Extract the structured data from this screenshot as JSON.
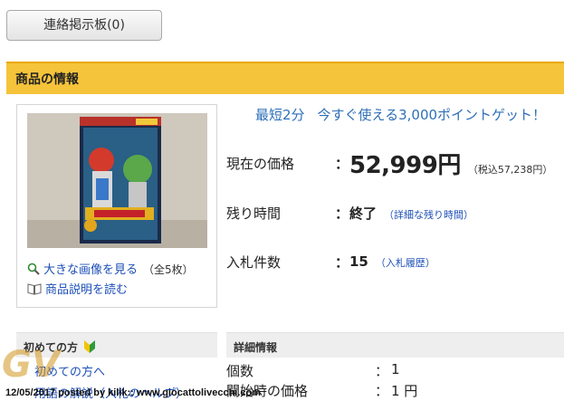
{
  "contact_button": {
    "label": "連絡掲示板(0)"
  },
  "section": {
    "title": "商品の情報"
  },
  "product": {
    "image_icon": "toy-box-photo",
    "enlarge_link": "大きな画像を見る",
    "image_count": "（全5枚）",
    "description_link": "商品説明を読む",
    "enlarge_icon": "magnifier-icon",
    "description_icon": "open-book-icon"
  },
  "promo": {
    "prefix": "最短2分",
    "text": "今すぐ使える3,000ポイントゲット！"
  },
  "info": {
    "price_label": "現在の価格",
    "colon": "：",
    "price_value": "52,999円",
    "price_tax": "（税込57,238円）",
    "time_label": "残り時間",
    "time_value": "終了",
    "time_link": "（詳細な残り時間）",
    "bids_label": "入札件数",
    "bids_value": "15",
    "bids_link": "（入札履歴）"
  },
  "left_panel": {
    "heading": "初めての方",
    "beginner_icon": "beginner-leaf-icon",
    "link1": "初めての方へ",
    "link2": "用語の解説（入札のヘルプ）"
  },
  "details": {
    "heading": "詳細情報",
    "rows": [
      {
        "key": "個数",
        "colon": "：",
        "value": "1"
      },
      {
        "key": "開始時の価格",
        "colon": "：",
        "value": "1 円"
      }
    ]
  },
  "watermark": {
    "logo": "GV",
    "caption": "12/05/2017 posted by kilik:: www.giocattolivecchi.com"
  },
  "colors": {
    "header_bar": "#f6c43a",
    "link": "#1d4fb8",
    "promo": "#2e6fb8"
  }
}
